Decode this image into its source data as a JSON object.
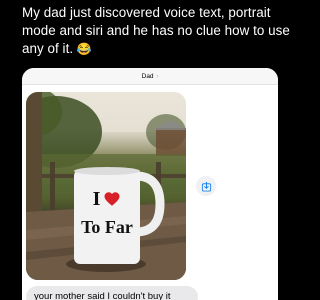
{
  "post": {
    "text": "My dad just discovered voice text, portrait mode and siri and he has no clue how to use any of it.",
    "emoji": "😂"
  },
  "conversation": {
    "contact_name": "Dad",
    "chevron": "›"
  },
  "photo": {
    "mug_line1": "I",
    "mug_line2": "To Far"
  },
  "message": {
    "text": "your mother said I couldn't buy it"
  },
  "colors": {
    "heart": "#d8202b",
    "save_icon": "#1a86f3",
    "bubble": "#e9e9eb"
  },
  "icons": {
    "save": "download-arrow-icon",
    "heart": "heart-icon"
  }
}
